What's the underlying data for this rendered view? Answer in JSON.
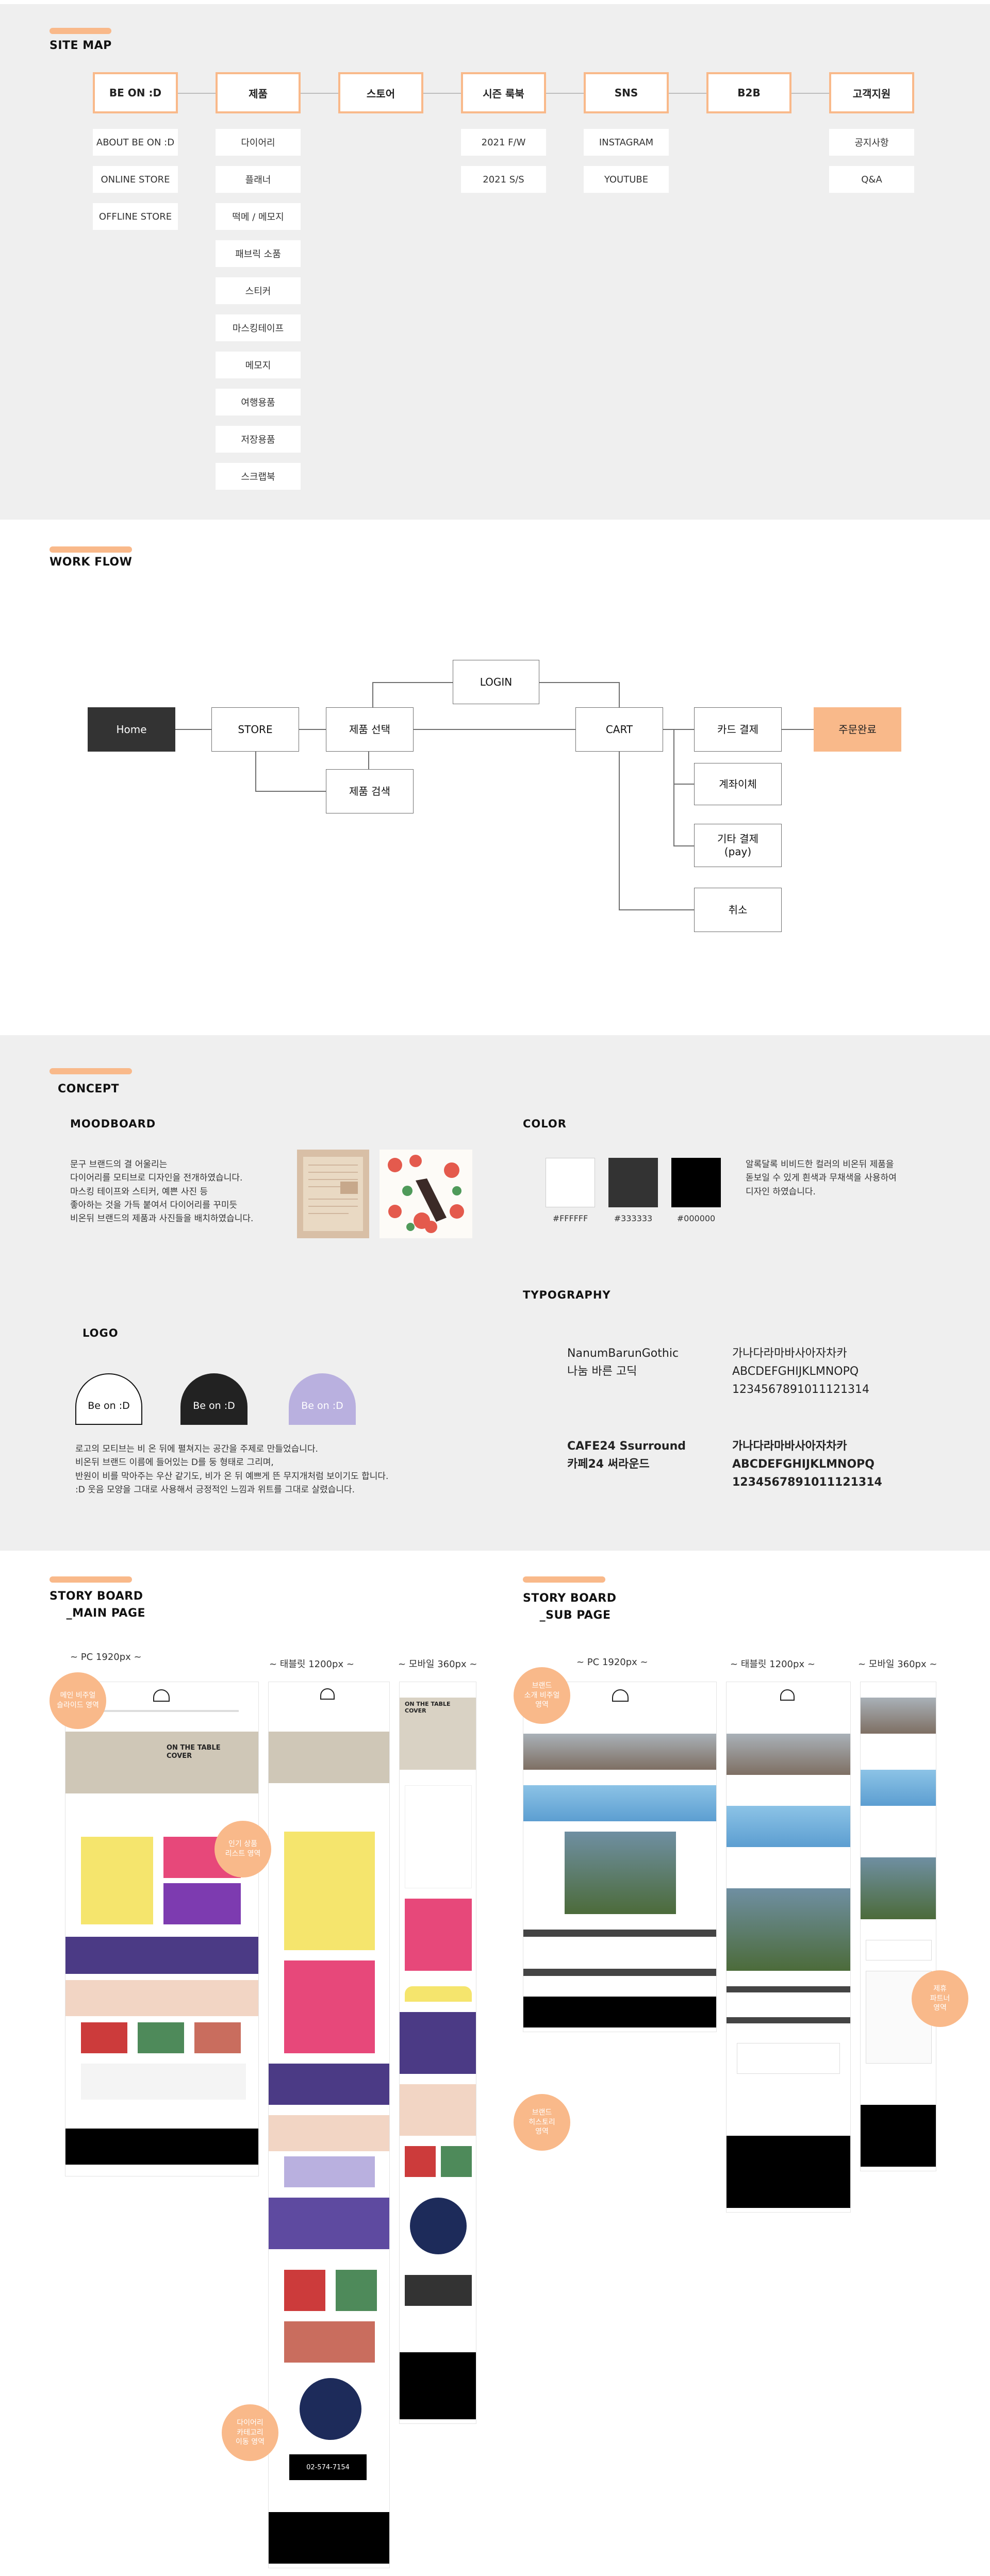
{
  "colors": {
    "accent": "#f9b98a",
    "dark": "#333333",
    "black": "#000000",
    "white": "#FFFFFF",
    "panel": "#efefef",
    "lavender": "#b9b0df"
  },
  "sitemap": {
    "title": "SITE MAP",
    "columns": [
      {
        "label": "BE ON :D",
        "items": [
          "ABOUT BE ON :D",
          "ONLINE STORE",
          "OFFLINE STORE"
        ]
      },
      {
        "label": "제품",
        "items": [
          "다이어리",
          "플래너",
          "떡메 / 메모지",
          "패브릭 소품",
          "스티커",
          "마스킹테이프",
          "메모지",
          "여행용품",
          "저장용품",
          "스크랩북"
        ]
      },
      {
        "label": "스토어",
        "items": []
      },
      {
        "label": "시즌 룩북",
        "items": [
          "2021 F/W",
          "2021 S/S"
        ]
      },
      {
        "label": "SNS",
        "items": [
          "INSTAGRAM",
          "YOUTUBE"
        ]
      },
      {
        "label": "B2B",
        "items": []
      },
      {
        "label": "고객지원",
        "items": [
          "공지사항",
          "Q&A"
        ]
      }
    ]
  },
  "workflow": {
    "title": "WORK FLOW",
    "home": "Home",
    "store": "STORE",
    "select": "제품 선택",
    "search": "제품 검색",
    "login": "LOGIN",
    "cart": "CART",
    "card": "카드 결제",
    "transfer": "계좌이체",
    "etc": "기타 결제\n(pay)",
    "cancel": "취소",
    "done": "주문완료"
  },
  "concept": {
    "title": "CONCEPT",
    "moodboard_title": "MOODBOARD",
    "moodboard_text": "문구 브랜드의 결 어울리는\n다이어리를 모티브로 디자인을 전개하였습니다.\n마스킹 테이프와 스티커, 예쁜 사진 등\n좋아하는 것을 가득 붙여서 다이어리를 꾸미듯\n비온뒤 브랜드의 제품과 사진들을 배치하였습니다.",
    "color_title": "COLOR",
    "swatches": [
      {
        "hex": "#FFFFFF",
        "label": "#FFFFFF"
      },
      {
        "hex": "#333333",
        "label": "#333333"
      },
      {
        "hex": "#000000",
        "label": "#000000"
      }
    ],
    "color_text": "알록달록 비비드한 컬러의 비온뒤 제품을\n돋보일 수 있게 흰색과 무채색을 사용하여\n디자인 하였습니다.",
    "typography_title": "TYPOGRAPHY",
    "fonts": [
      {
        "name": "NanumBarunGothic\n나눔 바른 고딕",
        "sample": "가나다라마바사아자차카\nABCDEFGHIJKLMNOPQ\n1234567891011121314"
      },
      {
        "name": "CAFE24 Ssurround\n카페24 써라운드",
        "sample": "가나다라마바사아자차카\nABCDEFGHIJKLMNOPQ\n1234567891011121314"
      }
    ],
    "logo_title": "LOGO",
    "logo_text": "Be on :D",
    "logo_desc": "로고의 모티브는 비 온 뒤에 펼쳐지는 공간을 주제로 만들었습니다.\n비온뒤 브랜드 이름에 들어있는 D를 둥 형태로 그리며,\n반원이 비를 막아주는 우산 같기도, 비가 온 뒤 예쁘게 뜬 무지개처럼 보이기도 합니다.\n:D 웃음 모양을 그대로 사용해서 긍정적인 느낌과 위트를 그대로 살렸습니다."
  },
  "storyboard": {
    "main_title": "STORY BOARD\n    _MAIN PAGE",
    "sub_title": "STORY BOARD\n    _SUB PAGE",
    "pc": "~ PC 1920px ~",
    "tablet": "~ 태블릿 1200px ~",
    "mobile": "~ 모바일 360px ~",
    "hero_text": "ON THE TABLE\nCOVER",
    "phone": "02-574-7154",
    "bubbles_main": [
      "메인 비주얼\n슬라이드 영역",
      "인기 상품\n리스트 영역",
      "다이어리\n카테고리\n이동 영역"
    ],
    "bubbles_sub": [
      "브랜드\n소개 비주얼\n영역",
      "브랜드\n히스토리\n영역",
      "제휴\n파트너\n영역"
    ]
  }
}
